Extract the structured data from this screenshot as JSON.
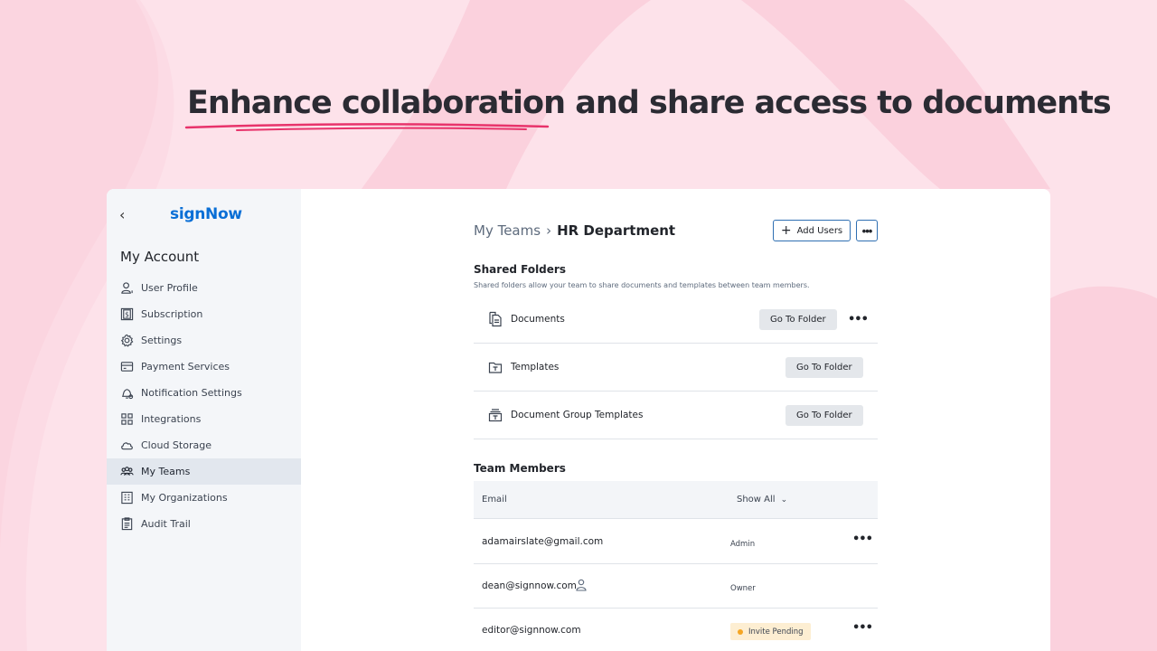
{
  "headline": {
    "highlight": "Enhance collaboration",
    "rest": " and share access to documents"
  },
  "colors": {
    "background": "#fde2ea",
    "accent_underline": "#e8336b",
    "brand": "#0a6fd6",
    "button_border": "#2f6fb2",
    "pending_dot": "#f5a623"
  },
  "sidebar": {
    "back_icon": "chevron-left-icon",
    "logo": "signNow",
    "title": "My Account",
    "items": [
      {
        "label": "User Profile",
        "icon": "user-icon"
      },
      {
        "label": "Subscription",
        "icon": "dollar-icon"
      },
      {
        "label": "Settings",
        "icon": "gear-icon"
      },
      {
        "label": "Payment Services",
        "icon": "credit-card-icon"
      },
      {
        "label": "Notification Settings",
        "icon": "bell-icon"
      },
      {
        "label": "Integrations",
        "icon": "integrations-icon"
      },
      {
        "label": "Cloud Storage",
        "icon": "cloud-icon"
      },
      {
        "label": "My Teams",
        "icon": "team-icon",
        "active": true
      },
      {
        "label": "My Organizations",
        "icon": "organization-icon"
      },
      {
        "label": "Audit Trail",
        "icon": "audit-icon"
      }
    ]
  },
  "main": {
    "breadcrumb": {
      "parent": "My Teams",
      "separator": "›",
      "current": "HR Department"
    },
    "add_users_label": "Add Users",
    "shared_folders": {
      "title": "Shared Folders",
      "description": "Shared folders allow your team to share documents and templates between team members.",
      "folders": [
        {
          "name": "Documents",
          "button": "Go To Folder",
          "has_menu": true
        },
        {
          "name": "Templates",
          "button": "Go To Folder",
          "has_menu": false
        },
        {
          "name": "Document Group Templates",
          "button": "Go To Folder",
          "has_menu": false
        }
      ]
    },
    "team_members": {
      "title": "Team Members",
      "col_email": "Email",
      "filter_label": "Show All",
      "members": [
        {
          "email": "adamairslate@gmail.com",
          "role": "Admin",
          "menu": true
        },
        {
          "email": "dean@signnow.com",
          "role": "Owner",
          "owner_icon": true,
          "menu": false
        },
        {
          "email": "editor@signnow.com",
          "role": "Invite Pending",
          "pending": true,
          "menu": true
        }
      ]
    }
  }
}
